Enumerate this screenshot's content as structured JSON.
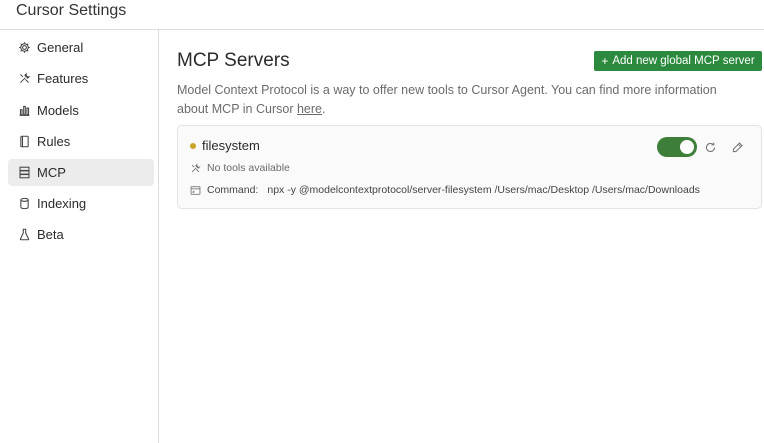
{
  "window": {
    "title": "Cursor Settings"
  },
  "sidebar": {
    "items": [
      {
        "label": "General",
        "icon": "gear-icon"
      },
      {
        "label": "Features",
        "icon": "tools-icon"
      },
      {
        "label": "Models",
        "icon": "bar-chart-icon"
      },
      {
        "label": "Rules",
        "icon": "book-icon"
      },
      {
        "label": "MCP",
        "icon": "server-icon",
        "active": true
      },
      {
        "label": "Indexing",
        "icon": "database-icon"
      },
      {
        "label": "Beta",
        "icon": "flask-icon"
      }
    ]
  },
  "main": {
    "heading": "MCP Servers",
    "add_button_label": "Add new global MCP server",
    "description_text": "Model Context Protocol is a way to offer new tools to Cursor Agent. You can find more information about MCP in Cursor ",
    "description_link": "here",
    "description_end": ".",
    "servers": [
      {
        "name": "filesystem",
        "status_color": "#c9a227",
        "enabled": true,
        "tools_text": "No tools available",
        "command_label": "Command:",
        "command_value": "npx -y @modelcontextprotocol/server-filesystem /Users/mac/Desktop /Users/mac/Downloads"
      }
    ]
  },
  "colors": {
    "accent_green": "#2b8a3e",
    "toggle_on": "#3d7f39",
    "active_nav_bg": "#ececec"
  }
}
